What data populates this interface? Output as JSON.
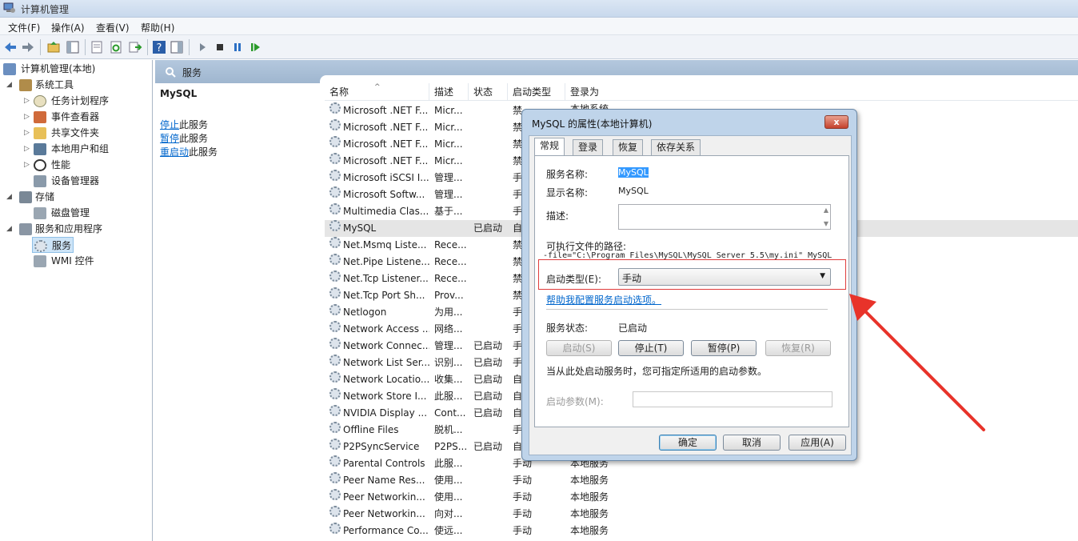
{
  "window": {
    "title": "计算机管理"
  },
  "menu": [
    "文件(F)",
    "操作(A)",
    "查看(V)",
    "帮助(H)"
  ],
  "tree": {
    "root": "计算机管理(本地)",
    "system_tools": "系统工具",
    "task_scheduler": "任务计划程序",
    "event_viewer": "事件查看器",
    "shared_folders": "共享文件夹",
    "local_users": "本地用户和组",
    "performance": "性能",
    "device_manager": "设备管理器",
    "storage": "存储",
    "disk_mgmt": "磁盘管理",
    "services_apps": "服务和应用程序",
    "services": "服务",
    "wmi": "WMI 控件"
  },
  "header": {
    "title": "服务"
  },
  "detail": {
    "name": "MySQL",
    "stop_link": "停止",
    "stop_rest": "此服务",
    "pause_link": "暂停",
    "pause_rest": "此服务",
    "restart_link": "重启动",
    "restart_rest": "此服务"
  },
  "columns": {
    "name": "名称",
    "desc": "描述",
    "status": "状态",
    "startup": "启动类型",
    "logon": "登录为"
  },
  "rows": [
    {
      "name": "Microsoft .NET F...",
      "desc": "Micr...",
      "status": "",
      "startup": "禁",
      "logon": ""
    },
    {
      "name": "Microsoft .NET F...",
      "desc": "Micr...",
      "status": "",
      "startup": "禁",
      "logon": ""
    },
    {
      "name": "Microsoft .NET F...",
      "desc": "Micr...",
      "status": "",
      "startup": "禁",
      "logon": ""
    },
    {
      "name": "Microsoft .NET F...",
      "desc": "Micr...",
      "status": "",
      "startup": "禁",
      "logon": ""
    },
    {
      "name": "Microsoft iSCSI I...",
      "desc": "管理...",
      "status": "",
      "startup": "手",
      "logon": ""
    },
    {
      "name": "Microsoft Softw...",
      "desc": "管理...",
      "status": "",
      "startup": "手",
      "logon": ""
    },
    {
      "name": "Multimedia Clas...",
      "desc": "基于...",
      "status": "",
      "startup": "手",
      "logon": ""
    },
    {
      "name": "MySQL",
      "desc": "",
      "status": "已启动",
      "startup": "自",
      "logon": ""
    },
    {
      "name": "Net.Msmq Liste...",
      "desc": "Rece...",
      "status": "",
      "startup": "禁",
      "logon": ""
    },
    {
      "name": "Net.Pipe Listene...",
      "desc": "Rece...",
      "status": "",
      "startup": "禁",
      "logon": ""
    },
    {
      "name": "Net.Tcp Listener...",
      "desc": "Rece...",
      "status": "",
      "startup": "禁",
      "logon": ""
    },
    {
      "name": "Net.Tcp Port Sh...",
      "desc": "Prov...",
      "status": "",
      "startup": "禁",
      "logon": ""
    },
    {
      "name": "Netlogon",
      "desc": "为用...",
      "status": "",
      "startup": "手",
      "logon": ""
    },
    {
      "name": "Network Access ...",
      "desc": "网络...",
      "status": "",
      "startup": "手",
      "logon": ""
    },
    {
      "name": "Network Connec...",
      "desc": "管理...",
      "status": "已启动",
      "startup": "手",
      "logon": ""
    },
    {
      "name": "Network List Ser...",
      "desc": "识别...",
      "status": "已启动",
      "startup": "手",
      "logon": ""
    },
    {
      "name": "Network Locatio...",
      "desc": "收集...",
      "status": "已启动",
      "startup": "自",
      "logon": ""
    },
    {
      "name": "Network Store I...",
      "desc": "此服...",
      "status": "已启动",
      "startup": "自",
      "logon": ""
    },
    {
      "name": "NVIDIA Display ...",
      "desc": "Cont...",
      "status": "已启动",
      "startup": "自",
      "logon": ""
    },
    {
      "name": "Offline Files",
      "desc": "脱机...",
      "status": "",
      "startup": "手",
      "logon": ""
    },
    {
      "name": "P2PSyncService",
      "desc": "P2PS...",
      "status": "已启动",
      "startup": "自",
      "logon": ""
    },
    {
      "name": "Parental Controls",
      "desc": "此服...",
      "status": "",
      "startup": "手动",
      "logon": "本地服务"
    },
    {
      "name": "Peer Name Res...",
      "desc": "使用...",
      "status": "",
      "startup": "手动",
      "logon": "本地服务"
    },
    {
      "name": "Peer Networkin...",
      "desc": "使用...",
      "status": "",
      "startup": "手动",
      "logon": "本地服务"
    },
    {
      "name": "Peer Networkin...",
      "desc": "向对...",
      "status": "",
      "startup": "手动",
      "logon": "本地服务"
    },
    {
      "name": "Performance Co...",
      "desc": "使远...",
      "status": "",
      "startup": "手动",
      "logon": "本地服务"
    }
  ],
  "first_row_logon_fragment": "本地系统",
  "dialog": {
    "title": "MySQL 的属性(本地计算机)",
    "close": "x",
    "tabs": [
      "常规",
      "登录",
      "恢复",
      "依存关系"
    ],
    "service_name_label": "服务名称:",
    "service_name": "MySQL",
    "display_name_label": "显示名称:",
    "display_name": "MySQL",
    "desc_label": "描述:",
    "path_label": "可执行文件的路径:",
    "path": "-file=\"C:\\Program Files\\MySQL\\MySQL Server 5.5\\my.ini\" MySQL",
    "startup_type_label": "启动类型(E):",
    "startup_type": "手动",
    "help_link": "帮助我配置服务启动选项。",
    "status_label": "服务状态:",
    "status": "已启动",
    "btn_start": "启动(S)",
    "btn_stop": "停止(T)",
    "btn_pause": "暂停(P)",
    "btn_resume": "恢复(R)",
    "params_hint": "当从此处启动服务时，您可指定所适用的启动参数。",
    "params_label": "启动参数(M):",
    "ok": "确定",
    "cancel": "取消",
    "apply": "应用(A)"
  },
  "colors": {
    "highlight_box": "#e03c3c",
    "arrow": "#e8332a",
    "link": "#0066cc"
  }
}
